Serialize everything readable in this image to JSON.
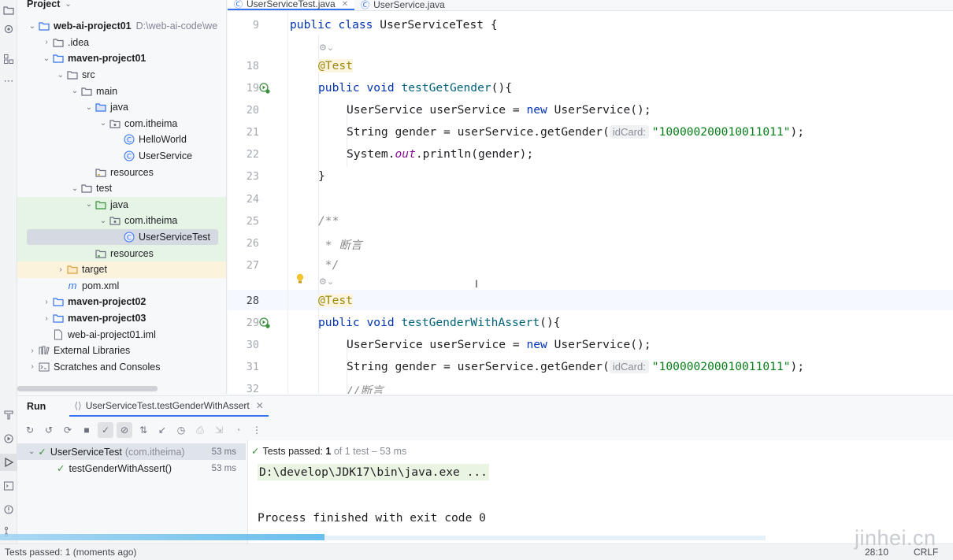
{
  "project_panel": {
    "title": "Project",
    "tree": [
      {
        "label": "web-ai-project01",
        "path": "D:\\web-ai-code\\we",
        "bold": true
      },
      {
        "label": ".idea"
      },
      {
        "label": "maven-project01",
        "bold": true
      },
      {
        "label": "src"
      },
      {
        "label": "main"
      },
      {
        "label": "java"
      },
      {
        "label": "com.itheima"
      },
      {
        "label": "HelloWorld"
      },
      {
        "label": "UserService"
      },
      {
        "label": "resources"
      },
      {
        "label": "test"
      },
      {
        "label": "java"
      },
      {
        "label": "com.itheima"
      },
      {
        "label": "UserServiceTest"
      },
      {
        "label": "resources"
      },
      {
        "label": "target"
      },
      {
        "label": "pom.xml"
      },
      {
        "label": "maven-project02",
        "bold": true
      },
      {
        "label": "maven-project03",
        "bold": true
      },
      {
        "label": "web-ai-project01.iml"
      },
      {
        "label": "External Libraries"
      },
      {
        "label": "Scratches and Consoles"
      }
    ]
  },
  "editor": {
    "tabs": [
      {
        "label": "UserServiceTest.java",
        "active": true
      },
      {
        "label": "UserService.java",
        "active": false
      }
    ],
    "line_numbers": [
      "9",
      "18",
      "19",
      "20",
      "21",
      "22",
      "23",
      "24",
      "25",
      "26",
      "27",
      "28",
      "29",
      "30",
      "31",
      "32"
    ],
    "class_decl": {
      "kw": "public class ",
      "name": "UserServiceTest",
      "rest": " {"
    },
    "annotation": "@Test",
    "method1": {
      "kw": "public void ",
      "name": "testGetGender",
      "rest": "(){"
    },
    "stmt_new": {
      "type": "UserService userService = ",
      "kw": "new",
      "rest": " UserService();"
    },
    "stmt_gender_pre": "String gender = userService.getGender(",
    "hint_label": "idCard:",
    "id_string": "\"100000200010011011\"",
    "stmt_gender_post": ");",
    "stmt_print_pre": "System.",
    "stmt_print_field": "out",
    "stmt_print_post": ".println(gender);",
    "close_brace": "}",
    "doc_open": "/**",
    "doc_body": " * 断言",
    "doc_close": " */",
    "method2": {
      "kw": "public void ",
      "name": "testGenderWithAssert",
      "rest": "(){"
    },
    "line_comment": "//断言"
  },
  "run_panel": {
    "title": "Run",
    "config_tab": "UserServiceTest.testGenderWithAssert",
    "tests": [
      {
        "name": "UserServiceTest",
        "pkg": "(com.itheima)",
        "time": "53 ms"
      },
      {
        "name": "testGenderWithAssert()",
        "pkg": "",
        "time": "53 ms"
      }
    ],
    "passed_label": "Tests passed:",
    "passed_count": "1",
    "passed_rest": "of 1 test – 53 ms",
    "command": "D:\\develop\\JDK17\\bin\\java.exe ...",
    "exit_message": "Process finished with exit code 0"
  },
  "status_bar": {
    "message": "Tests passed: 1 (moments ago)",
    "position": "28:10",
    "encoding": "CRLF"
  },
  "watermark": "jinhei.cn",
  "colors": {
    "accent": "#3574f0",
    "pass_green": "#3e8f3e",
    "keyword": "#0033b3",
    "string": "#067d17",
    "annotation": "#9e880d"
  }
}
